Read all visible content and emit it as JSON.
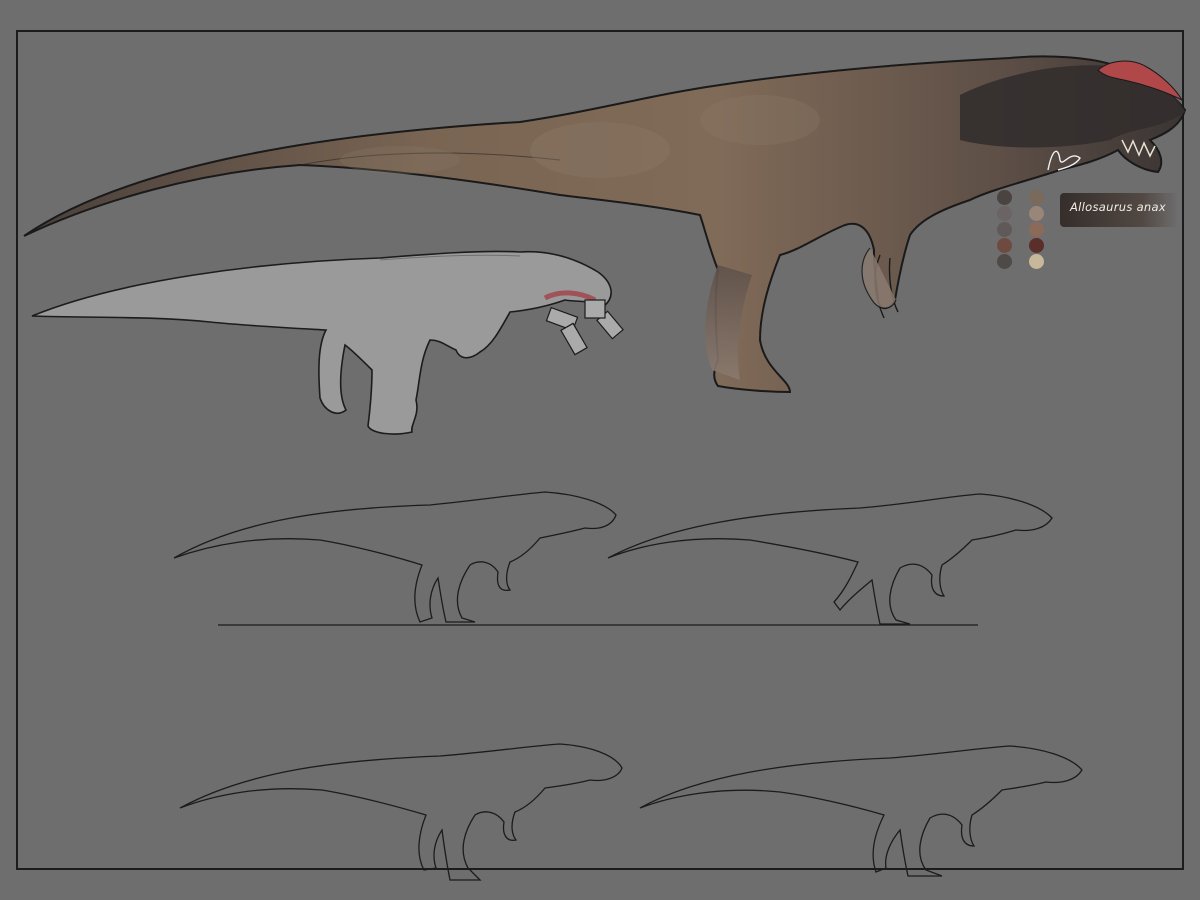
{
  "species_label": "Allosaurus anax",
  "colors": {
    "background": "#6e6e6e",
    "body_tan": "#7b6654",
    "body_dark": "#3f3634",
    "crest_red": "#b0484a"
  },
  "palette": [
    "#4a4340",
    "#7a6a5c",
    "#6a6464",
    "#9a8678",
    "#5f5a58",
    "#8c6a5a",
    "#6e4a40",
    "#5a2e2a",
    "#4e4a48",
    "#c8b89a"
  ]
}
